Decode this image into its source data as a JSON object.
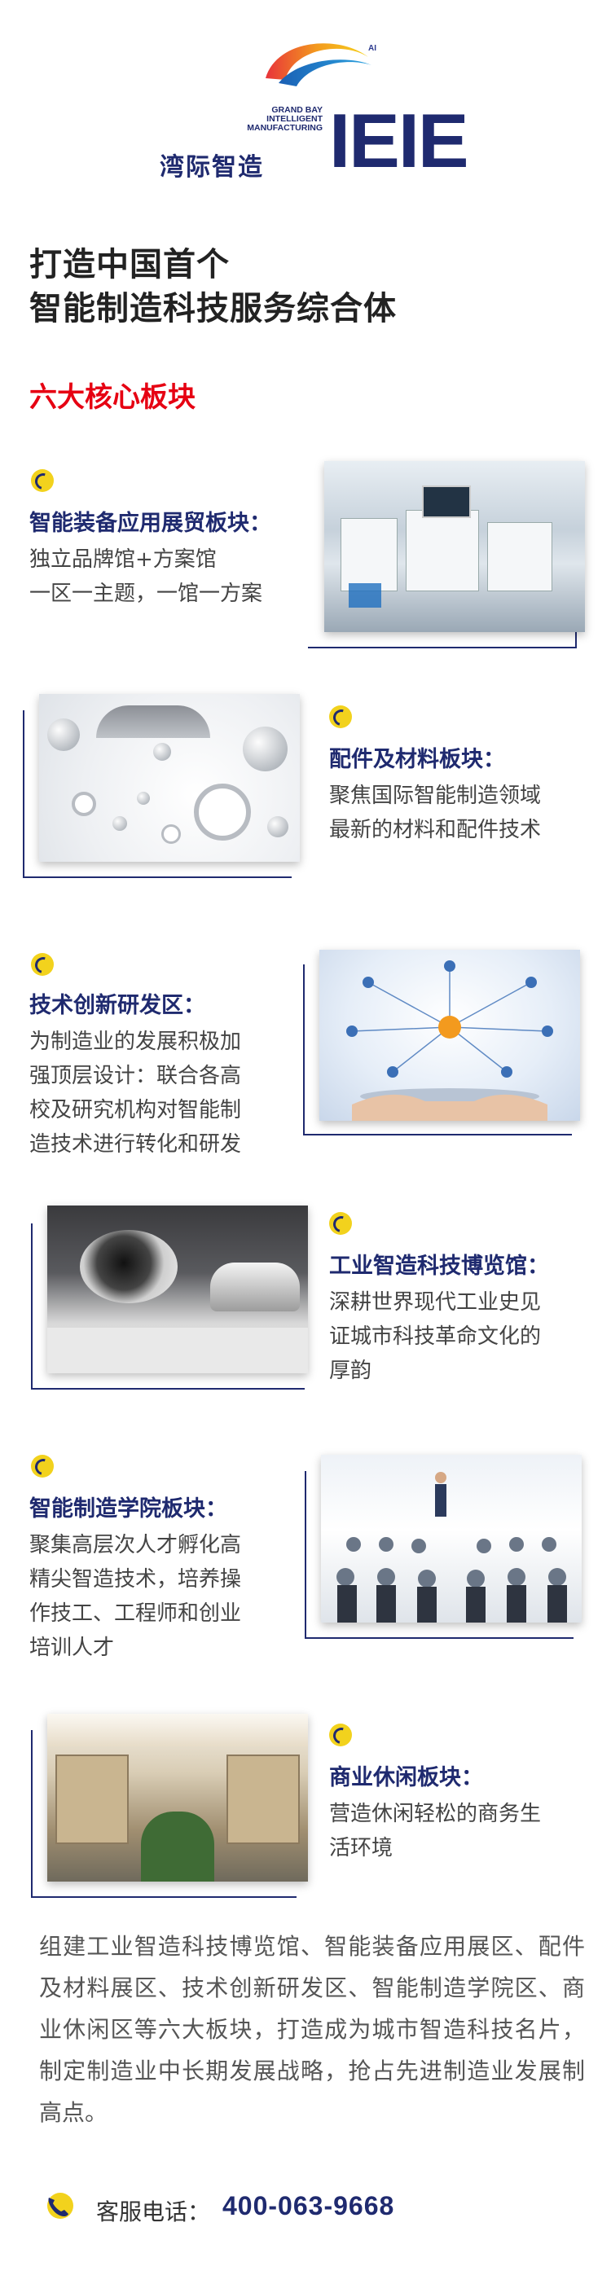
{
  "header": {
    "logo_ai": "AI",
    "logo_en_lines": [
      "GRAND BAY",
      "INTELLIGENT",
      "MANUFACTURING"
    ],
    "logo_cn": "湾际智造",
    "logo_mark": "IEIE"
  },
  "headline": {
    "line1": "打造中国首个",
    "line2": "智能制造科技服务综合体",
    "subtitle": "六大核心板块"
  },
  "sections": [
    {
      "title": "智能装备应用展贸板块：",
      "body": [
        "独立品牌馆+方案馆",
        "一区一主题，一馆一方案"
      ],
      "icon": "target-dot-icon",
      "image": "equipment-photo"
    },
    {
      "title": "配件及材料板块：",
      "body": [
        "聚焦国际智能制造领域",
        "最新的材料和配件技术"
      ],
      "icon": "target-dot-icon",
      "image": "magnets-photo"
    },
    {
      "title": "技术创新研发区：",
      "body": [
        "为制造业的发展积极加",
        "强顶层设计：联合各高",
        "校及研究机构对智能制",
        "造技术进行转化和研发"
      ],
      "icon": "target-dot-icon",
      "image": "circuit-photo"
    },
    {
      "title": "工业智造科技博览馆：",
      "body": [
        "深耕世界现代工业史见",
        "证城市科技革命文化的",
        "厚韵"
      ],
      "icon": "target-dot-icon",
      "image": "museum-photo"
    },
    {
      "title": "智能制造学院板块：",
      "body": [
        "聚集高层次人才孵化高",
        "精尖智造技术，培养操",
        "作技工、工程师和创业",
        "培训人才"
      ],
      "icon": "target-dot-icon",
      "image": "seminar-photo"
    },
    {
      "title": "商业休闲板块：",
      "body": [
        "营造休闲轻松的商务生",
        "活环境"
      ],
      "icon": "target-dot-icon",
      "image": "mall-photo"
    }
  ],
  "summary": "组建工业智造科技博览馆、智能装备应用展区、配件及材料展区、技术创新研发区、智能制造学院区、商业休闲区等六大板块，打造成为城市智造科技名片，制定制造业中长期发展战略，抢占先进制造业发展制高点。",
  "contact": {
    "label": "客服电话：",
    "number": "400-063-9668",
    "icon": "phone-icon"
  },
  "colors": {
    "brand_navy": "#1f2a6f",
    "accent_red": "#e60012",
    "accent_yellow": "#f2d21d"
  }
}
